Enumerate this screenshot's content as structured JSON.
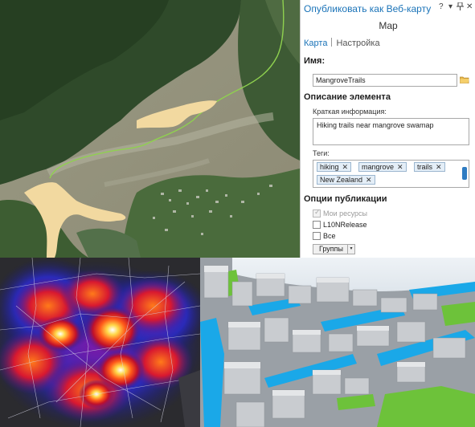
{
  "pane": {
    "title": "Опубликовать как Веб-карту",
    "controls": {
      "help": "?",
      "pin": "▾",
      "pin_icon": "pin-icon",
      "close": "✕"
    },
    "subtitle": "Map",
    "tabs": [
      {
        "label": "Карта",
        "active": true
      },
      {
        "label": "Настройка",
        "active": false
      }
    ],
    "name_section": {
      "label": "Имя:",
      "value": "MangroveTrails",
      "browse_icon": "folder-icon"
    },
    "description_section": {
      "label": "Описание элемента",
      "summary_label": "Краткая информация:",
      "summary_value": "Hiking trails near mangrove swamap",
      "tags_label": "Теги:",
      "tags": [
        "hiking",
        "mangrove",
        "trails",
        "New Zealand"
      ],
      "tag_remove": "✕"
    },
    "publish_options": {
      "label": "Опции публикации",
      "options": [
        {
          "label": "Мои ресурсы",
          "checked": true,
          "disabled": true
        },
        {
          "label": "L10NRelease",
          "checked": false,
          "disabled": false
        },
        {
          "label": "Все",
          "checked": false,
          "disabled": false
        }
      ],
      "groups_button": "Группы",
      "groups_arrow": "▾"
    },
    "accent_color": "#1a73b8"
  },
  "imagery": {
    "aerial": {
      "description_icon": "aerial-map-image",
      "trail_color": "#8fd14f",
      "polygon_color": "#f2d9a0"
    },
    "heatmap": {
      "icon": "heatmap-image"
    },
    "scene": {
      "icon": "3d-buildings-image",
      "water_color": "#1aa8e8",
      "vegetation_color": "#6dc23a"
    }
  }
}
